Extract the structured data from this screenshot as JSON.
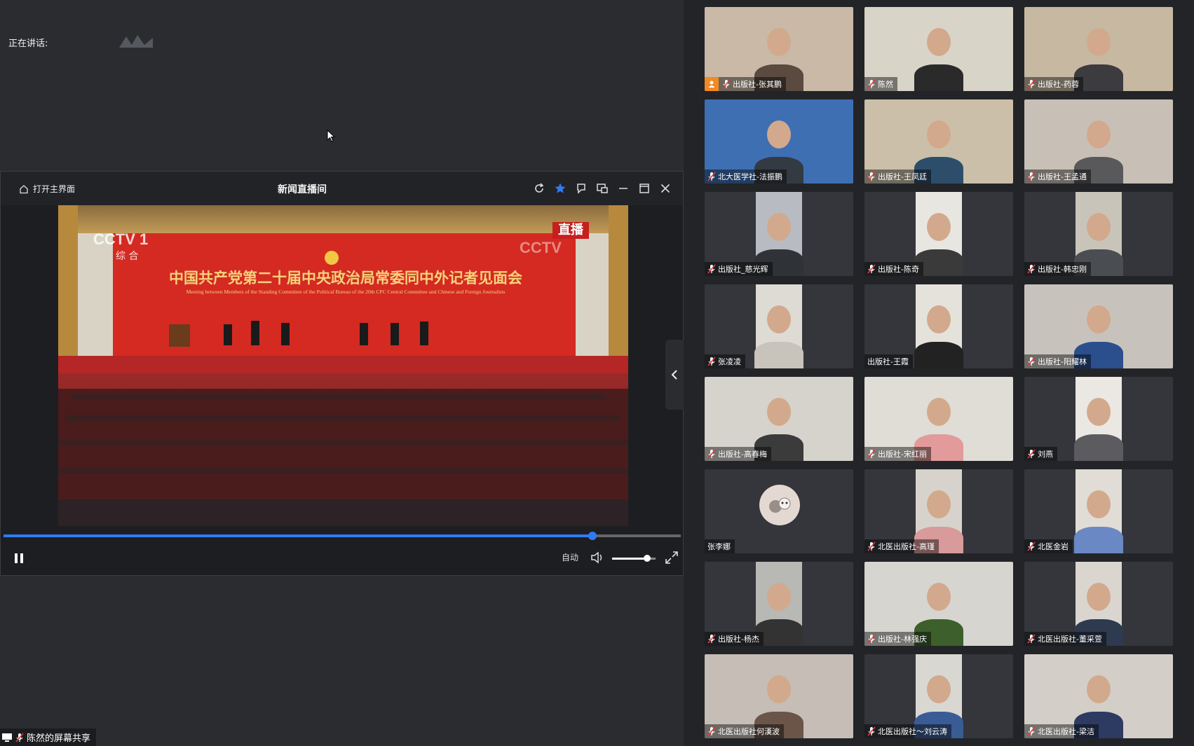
{
  "share": {
    "speaking_label": "正在讲话:",
    "footer_label": "陈然的屏幕共享"
  },
  "player": {
    "home_label": "打开主界面",
    "title": "新闻直播间",
    "quality": "自动",
    "progress": 0.87,
    "volume": 0.8,
    "accent_color": "#2f7bf5"
  },
  "broadcast": {
    "channel_logo": "CCTV 1",
    "channel_sub": "综 合",
    "live_badge": "直播",
    "watermark": "CCTV",
    "headline": "中国共产党第二十届中央政治局常委同中外记者见面会",
    "subline": "Meeting between Members of the Standing Committee of the Political Bureau of the 20th CPC Central Committee and Chinese and Foreign Journalists"
  },
  "participants": [
    {
      "name": "出版社-张其鹏",
      "host": true
    },
    {
      "name": "陈然"
    },
    {
      "name": "出版社-药蓉"
    },
    {
      "name": "北大医学社-法振鹏"
    },
    {
      "name": "出版社-王凤廷"
    },
    {
      "name": "出版社-王孟通"
    },
    {
      "name": "出版社_慈光辉"
    },
    {
      "name": "出版社-陈奇"
    },
    {
      "name": "出版社-韩忠刚"
    },
    {
      "name": "张凌凌"
    },
    {
      "name": "出版社-王霞",
      "mic": false
    },
    {
      "name": "出版社-阳耀林"
    },
    {
      "name": "出版社-高春梅"
    },
    {
      "name": "出版社-宋红丽"
    },
    {
      "name": "刘燕"
    },
    {
      "name": "张李娜",
      "mic": false,
      "avatar": true
    },
    {
      "name": "北医出版社-高瑾"
    },
    {
      "name": "北医金岩"
    },
    {
      "name": "出版社-杨杰"
    },
    {
      "name": "出版社-林强庆"
    },
    {
      "name": "北医出版社-董采萱"
    },
    {
      "name": "北医出版社何漢波"
    },
    {
      "name": "北医出版社～刘云涛"
    },
    {
      "name": "北医出版社-梁洁"
    }
  ]
}
